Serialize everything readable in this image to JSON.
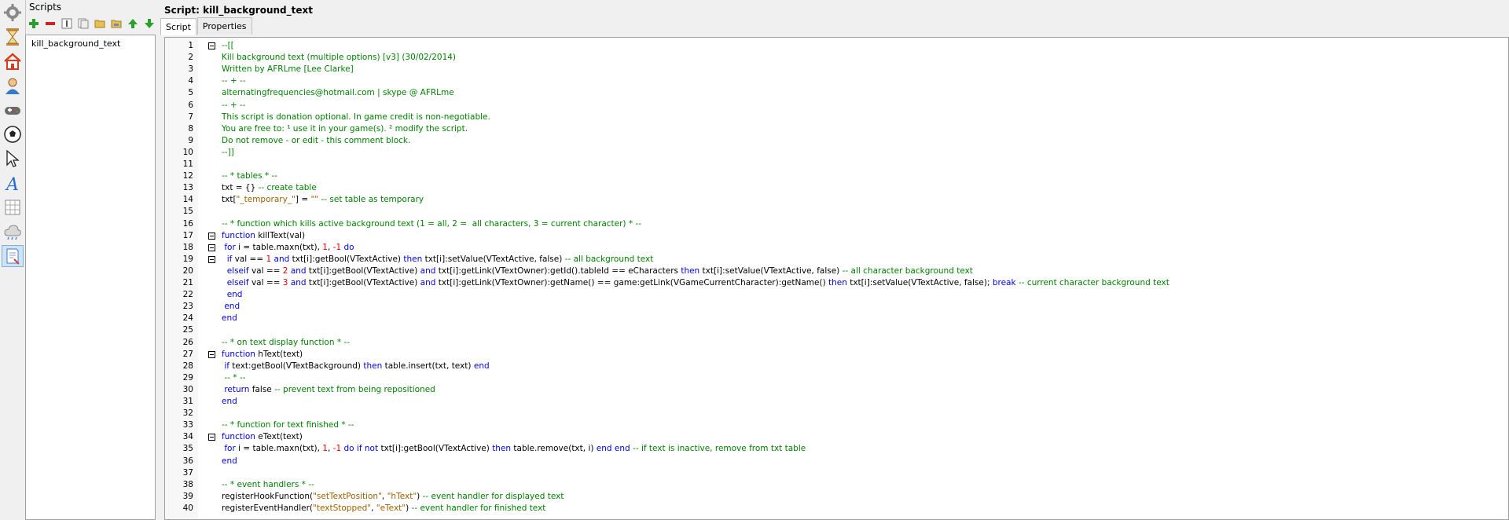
{
  "left_toolbar": {
    "icons": [
      "gear-icon",
      "hourglass-icon",
      "house-icon",
      "character-icon",
      "gamepad-icon",
      "ball-icon",
      "cursor-icon",
      "font-icon",
      "grid-icon",
      "cloud-icon",
      "script-icon"
    ],
    "active_index": 10
  },
  "scripts_panel": {
    "title": "Scripts",
    "toolbar": [
      "add-icon",
      "remove-icon",
      "rename-icon",
      "copy-icon",
      "folder-icon",
      "save-icon",
      "move-up-icon",
      "move-down-icon"
    ],
    "items": [
      "kill_background_text"
    ]
  },
  "main": {
    "title": "Script: kill_background_text",
    "tabs": [
      {
        "label": "Script"
      },
      {
        "label": "Properties"
      }
    ],
    "active_tab": 0
  },
  "colors": {
    "comment": "#008000",
    "keyword": "#0000e0",
    "string": "#a06000",
    "number": "#e00000"
  },
  "code": {
    "lines": [
      {
        "n": "1",
        "fold": true,
        "parts": [
          [
            "c",
            "--[["
          ]
        ]
      },
      {
        "n": "2",
        "fold": false,
        "parts": [
          [
            "c",
            "Kill background text (multiple options) [v3] (30/02/2014)"
          ]
        ]
      },
      {
        "n": "3",
        "fold": false,
        "parts": [
          [
            "c",
            "Written by AFRLme [Lee Clarke]"
          ]
        ]
      },
      {
        "n": "4",
        "fold": false,
        "parts": [
          [
            "c",
            "-- + --"
          ]
        ]
      },
      {
        "n": "5",
        "fold": false,
        "parts": [
          [
            "c",
            "alternatingfrequencies@hotmail.com | skype @ AFRLme"
          ]
        ]
      },
      {
        "n": "6",
        "fold": false,
        "parts": [
          [
            "c",
            "-- + --"
          ]
        ]
      },
      {
        "n": "7",
        "fold": false,
        "parts": [
          [
            "c",
            "This script is donation optional. In game credit is non-negotiable."
          ]
        ]
      },
      {
        "n": "8",
        "fold": false,
        "parts": [
          [
            "c",
            "You are free to: ¹ use it in your game(s). ² modify the script."
          ]
        ]
      },
      {
        "n": "9",
        "fold": false,
        "parts": [
          [
            "c",
            "Do not remove - or edit - this comment block."
          ]
        ]
      },
      {
        "n": "10",
        "fold": false,
        "parts": [
          [
            "c",
            "--]]"
          ]
        ]
      },
      {
        "n": "11",
        "fold": false,
        "parts": []
      },
      {
        "n": "12",
        "fold": false,
        "parts": [
          [
            "c",
            "-- * tables * --"
          ]
        ]
      },
      {
        "n": "13",
        "fold": false,
        "parts": [
          [
            "p",
            "txt = {} "
          ],
          [
            "c",
            "-- create table"
          ]
        ]
      },
      {
        "n": "14",
        "fold": false,
        "parts": [
          [
            "p",
            "txt["
          ],
          [
            "s",
            "\"_temporary_\""
          ],
          [
            "p",
            "] = "
          ],
          [
            "s",
            "\"\""
          ],
          [
            "p",
            " "
          ],
          [
            "c",
            "-- set table as temporary"
          ]
        ]
      },
      {
        "n": "15",
        "fold": false,
        "parts": []
      },
      {
        "n": "16",
        "fold": false,
        "parts": [
          [
            "c",
            "-- * function which kills active background text (1 = all, 2 =  all characters, 3 = current character) * --"
          ]
        ]
      },
      {
        "n": "17",
        "fold": true,
        "parts": [
          [
            "k",
            "function"
          ],
          [
            "p",
            " killText(val)"
          ]
        ]
      },
      {
        "n": "18",
        "fold": true,
        "parts": [
          [
            "p",
            " "
          ],
          [
            "k",
            "for"
          ],
          [
            "p",
            " i = table.maxn(txt), "
          ],
          [
            "n",
            "1"
          ],
          [
            "p",
            ", "
          ],
          [
            "n",
            "-1"
          ],
          [
            "p",
            " "
          ],
          [
            "k",
            "do"
          ]
        ]
      },
      {
        "n": "19",
        "fold": true,
        "parts": [
          [
            "p",
            "  "
          ],
          [
            "k",
            "if"
          ],
          [
            "p",
            " val == "
          ],
          [
            "n",
            "1"
          ],
          [
            "p",
            " "
          ],
          [
            "k",
            "and"
          ],
          [
            "p",
            " txt[i]:getBool(VTextActive) "
          ],
          [
            "k",
            "then"
          ],
          [
            "p",
            " txt[i]:setValue(VTextActive, false) "
          ],
          [
            "c",
            "-- all background text"
          ]
        ]
      },
      {
        "n": "20",
        "fold": false,
        "parts": [
          [
            "p",
            "  "
          ],
          [
            "k",
            "elseif"
          ],
          [
            "p",
            " val == "
          ],
          [
            "n",
            "2"
          ],
          [
            "p",
            " "
          ],
          [
            "k",
            "and"
          ],
          [
            "p",
            " txt[i]:getBool(VTextActive) "
          ],
          [
            "k",
            "and"
          ],
          [
            "p",
            " txt[i]:getLink(VTextOwner):getId().tableId == eCharacters "
          ],
          [
            "k",
            "then"
          ],
          [
            "p",
            " txt[i]:setValue(VTextActive, false) "
          ],
          [
            "c",
            "-- all character background text"
          ]
        ]
      },
      {
        "n": "21",
        "fold": false,
        "parts": [
          [
            "p",
            "  "
          ],
          [
            "k",
            "elseif"
          ],
          [
            "p",
            " val == "
          ],
          [
            "n",
            "3"
          ],
          [
            "p",
            " "
          ],
          [
            "k",
            "and"
          ],
          [
            "p",
            " txt[i]:getBool(VTextActive) "
          ],
          [
            "k",
            "and"
          ],
          [
            "p",
            " txt[i]:getLink(VTextOwner):getName() == game:getLink(VGameCurrentCharacter):getName() "
          ],
          [
            "k",
            "then"
          ],
          [
            "p",
            " txt[i]:setValue(VTextActive, false); "
          ],
          [
            "k",
            "break"
          ],
          [
            "p",
            " "
          ],
          [
            "c",
            "-- current character background text"
          ]
        ]
      },
      {
        "n": "22",
        "fold": false,
        "parts": [
          [
            "p",
            "  "
          ],
          [
            "k",
            "end"
          ]
        ]
      },
      {
        "n": "23",
        "fold": false,
        "parts": [
          [
            "p",
            " "
          ],
          [
            "k",
            "end"
          ]
        ]
      },
      {
        "n": "24",
        "fold": false,
        "parts": [
          [
            "k",
            "end"
          ]
        ]
      },
      {
        "n": "25",
        "fold": false,
        "parts": []
      },
      {
        "n": "26",
        "fold": false,
        "parts": [
          [
            "c",
            "-- * on text display function * --"
          ]
        ]
      },
      {
        "n": "27",
        "fold": true,
        "parts": [
          [
            "k",
            "function"
          ],
          [
            "p",
            " hText(text)"
          ]
        ]
      },
      {
        "n": "28",
        "fold": false,
        "parts": [
          [
            "p",
            " "
          ],
          [
            "k",
            "if"
          ],
          [
            "p",
            " text:getBool(VTextBackground) "
          ],
          [
            "k",
            "then"
          ],
          [
            "p",
            " table.insert(txt, text) "
          ],
          [
            "k",
            "end"
          ]
        ]
      },
      {
        "n": "29",
        "fold": false,
        "parts": [
          [
            "p",
            " "
          ],
          [
            "c",
            "-- * --"
          ]
        ]
      },
      {
        "n": "30",
        "fold": false,
        "parts": [
          [
            "p",
            " "
          ],
          [
            "k",
            "return"
          ],
          [
            "p",
            " false "
          ],
          [
            "c",
            "-- prevent text from being repositioned"
          ]
        ]
      },
      {
        "n": "31",
        "fold": false,
        "parts": [
          [
            "k",
            "end"
          ]
        ]
      },
      {
        "n": "32",
        "fold": false,
        "parts": []
      },
      {
        "n": "33",
        "fold": false,
        "parts": [
          [
            "c",
            "-- * function for text finished * --"
          ]
        ]
      },
      {
        "n": "34",
        "fold": true,
        "parts": [
          [
            "k",
            "function"
          ],
          [
            "p",
            " eText(text)"
          ]
        ]
      },
      {
        "n": "35",
        "fold": false,
        "parts": [
          [
            "p",
            " "
          ],
          [
            "k",
            "for"
          ],
          [
            "p",
            " i = table.maxn(txt), "
          ],
          [
            "n",
            "1"
          ],
          [
            "p",
            ", "
          ],
          [
            "n",
            "-1"
          ],
          [
            "p",
            " "
          ],
          [
            "k",
            "do"
          ],
          [
            "p",
            " "
          ],
          [
            "k",
            "if"
          ],
          [
            "p",
            " "
          ],
          [
            "k",
            "not"
          ],
          [
            "p",
            " txt[i]:getBool(VTextActive) "
          ],
          [
            "k",
            "then"
          ],
          [
            "p",
            " table.remove(txt, i) "
          ],
          [
            "k",
            "end"
          ],
          [
            "p",
            " "
          ],
          [
            "k",
            "end"
          ],
          [
            "p",
            " "
          ],
          [
            "c",
            "-- if text is inactive, remove from txt table"
          ]
        ]
      },
      {
        "n": "36",
        "fold": false,
        "parts": [
          [
            "k",
            "end"
          ]
        ]
      },
      {
        "n": "37",
        "fold": false,
        "parts": []
      },
      {
        "n": "38",
        "fold": false,
        "parts": [
          [
            "c",
            "-- * event handlers * --"
          ]
        ]
      },
      {
        "n": "39",
        "fold": false,
        "parts": [
          [
            "p",
            "registerHookFunction("
          ],
          [
            "s",
            "\"setTextPosition\""
          ],
          [
            "p",
            ", "
          ],
          [
            "s",
            "\"hText\""
          ],
          [
            "p",
            ") "
          ],
          [
            "c",
            "-- event handler for displayed text"
          ]
        ]
      },
      {
        "n": "40",
        "fold": false,
        "parts": [
          [
            "p",
            "registerEventHandler("
          ],
          [
            "s",
            "\"textStopped\""
          ],
          [
            "p",
            ", "
          ],
          [
            "s",
            "\"eText\""
          ],
          [
            "p",
            ") "
          ],
          [
            "c",
            "-- event handler for finished text"
          ]
        ]
      }
    ]
  }
}
